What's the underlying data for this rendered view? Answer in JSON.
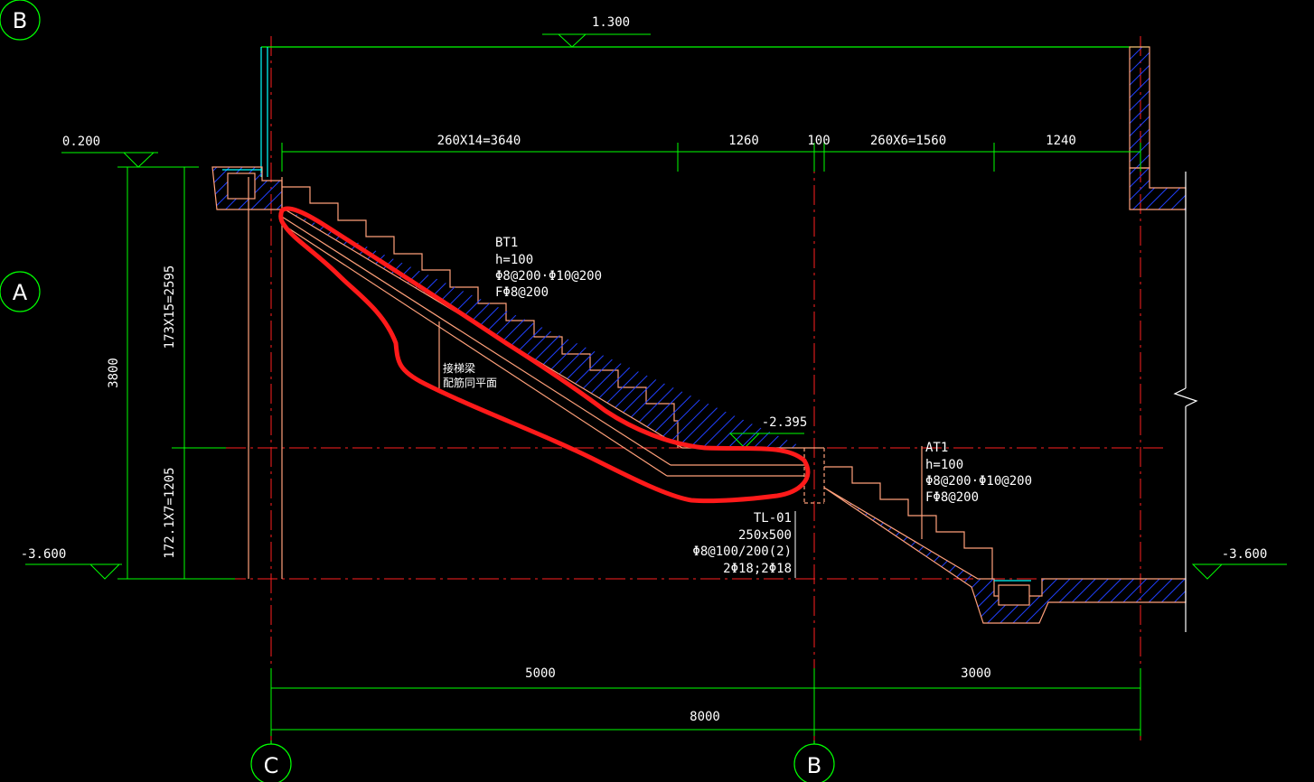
{
  "drawing": {
    "axes": {
      "b_top": "B",
      "a": "A",
      "c": "C",
      "b_bottom": "B"
    },
    "elevations": {
      "top": "1.300",
      "left_upper": "0.200",
      "left_lower": "-3.600",
      "right_lower": "-3.600",
      "landing": "-2.395"
    },
    "dims_top": {
      "d1": "260X14=3640",
      "d2": "1260",
      "d3": "100",
      "d4": "260X6=1560",
      "d5": "1240"
    },
    "dims_left": {
      "total": "3800",
      "upper": "173X15=2595",
      "lower": "172.1X7=1205"
    },
    "dims_bottom": {
      "left": "5000",
      "right": "3000",
      "total": "8000"
    },
    "bt1": {
      "name": "BT1",
      "h": "h=100",
      "bars": "Φ8@200·Φ10@200",
      "f": "FΦ8@200"
    },
    "at1": {
      "name": "AT1",
      "h": "h=100",
      "bars": "Φ8@200·Φ10@200",
      "f": "FΦ8@200"
    },
    "tl": {
      "name": "TL-01",
      "size": "250x500",
      "stirrup": "Φ8@100/200(2)",
      "bars": "2Φ18;2Φ18"
    },
    "beam_note": {
      "line1": "接梯梁",
      "line2": "配筋同平面"
    },
    "colors": {
      "background": "#000000",
      "dim_green": "#00ff00",
      "axis_red": "#ff2020",
      "structure": "#ffa07a",
      "hatch": "#2040ff",
      "highlight": "#ff1a1a",
      "cyan": "#00ffff"
    }
  }
}
